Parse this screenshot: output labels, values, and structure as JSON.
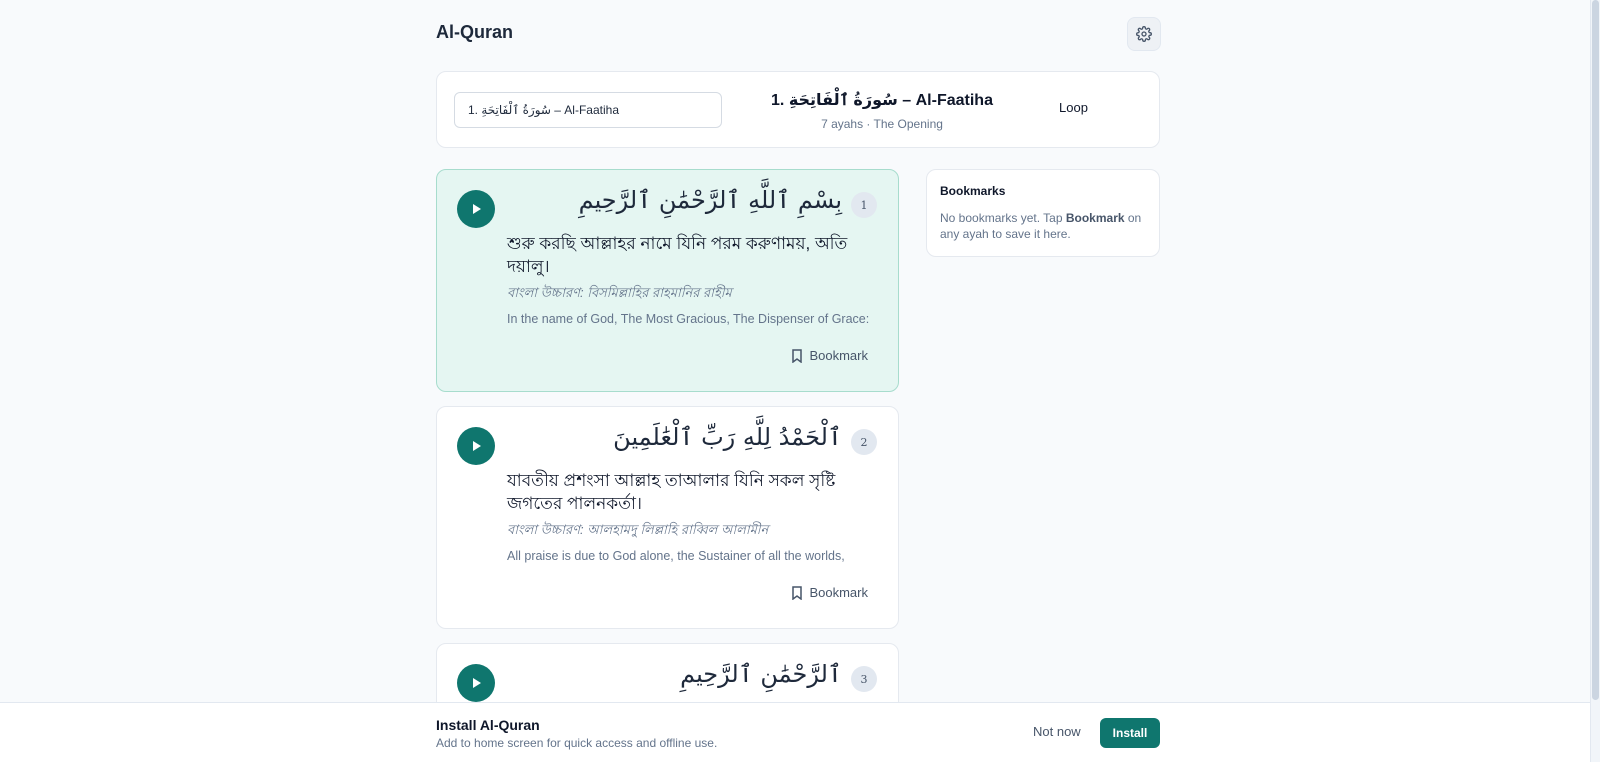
{
  "app": {
    "title": "Al-Quran"
  },
  "surah": {
    "select_value": "1. سُورَةُ ٱلْفَاتِحَةِ – Al-Faatiha",
    "heading": "1. سُورَةُ ٱلْفَاتِحَةِ – Al-Faatiha",
    "meta": "7 ayahs · The Opening",
    "loop_label": "Loop"
  },
  "ayahs": [
    {
      "number": "1",
      "arabic": "بِسْمِ ٱللَّهِ ٱلرَّحْمَٰنِ ٱلرَّحِيمِ",
      "bangla": "শুরু করছি আল্লাহর নামে যিনি পরম করুণাময়, অতি দয়ালু।",
      "translit": "বাংলা উচ্চারণ: বিসমিল্লাহির রাহমানির রাহীম",
      "english": "In the name of God, The Most Gracious, The Dispenser of Grace:",
      "bookmark_label": "Bookmark"
    },
    {
      "number": "2",
      "arabic": "ٱلْحَمْدُ لِلَّهِ رَبِّ ٱلْعَٰلَمِينَ",
      "bangla": "যাবতীয় প্রশংসা আল্লাহ তাআলার যিনি সকল সৃষ্টি জগতের পালনকর্তা।",
      "translit": "বাংলা উচ্চারণ: আলহামদু লিল্লাহি রাব্বিল আলামীন",
      "english": "All praise is due to God alone, the Sustainer of all the worlds,",
      "bookmark_label": "Bookmark"
    },
    {
      "number": "3",
      "arabic": "ٱلرَّحْمَٰنِ ٱلرَّحِيمِ"
    }
  ],
  "bookmarks": {
    "title": "Bookmarks",
    "empty_prefix": "No bookmarks yet. Tap ",
    "empty_bold": "Bookmark",
    "empty_suffix": " on any ayah to save it here."
  },
  "install": {
    "title": "Install Al-Quran",
    "description": "Add to home screen for quick access and offline use.",
    "not_now_label": "Not now",
    "install_label": "Install"
  },
  "colors": {
    "accent": "#0f766e",
    "active_card_bg": "#e5f6f2"
  },
  "icons": {
    "settings": "gear-icon",
    "play": "play-icon",
    "bookmark": "bookmark-icon"
  }
}
